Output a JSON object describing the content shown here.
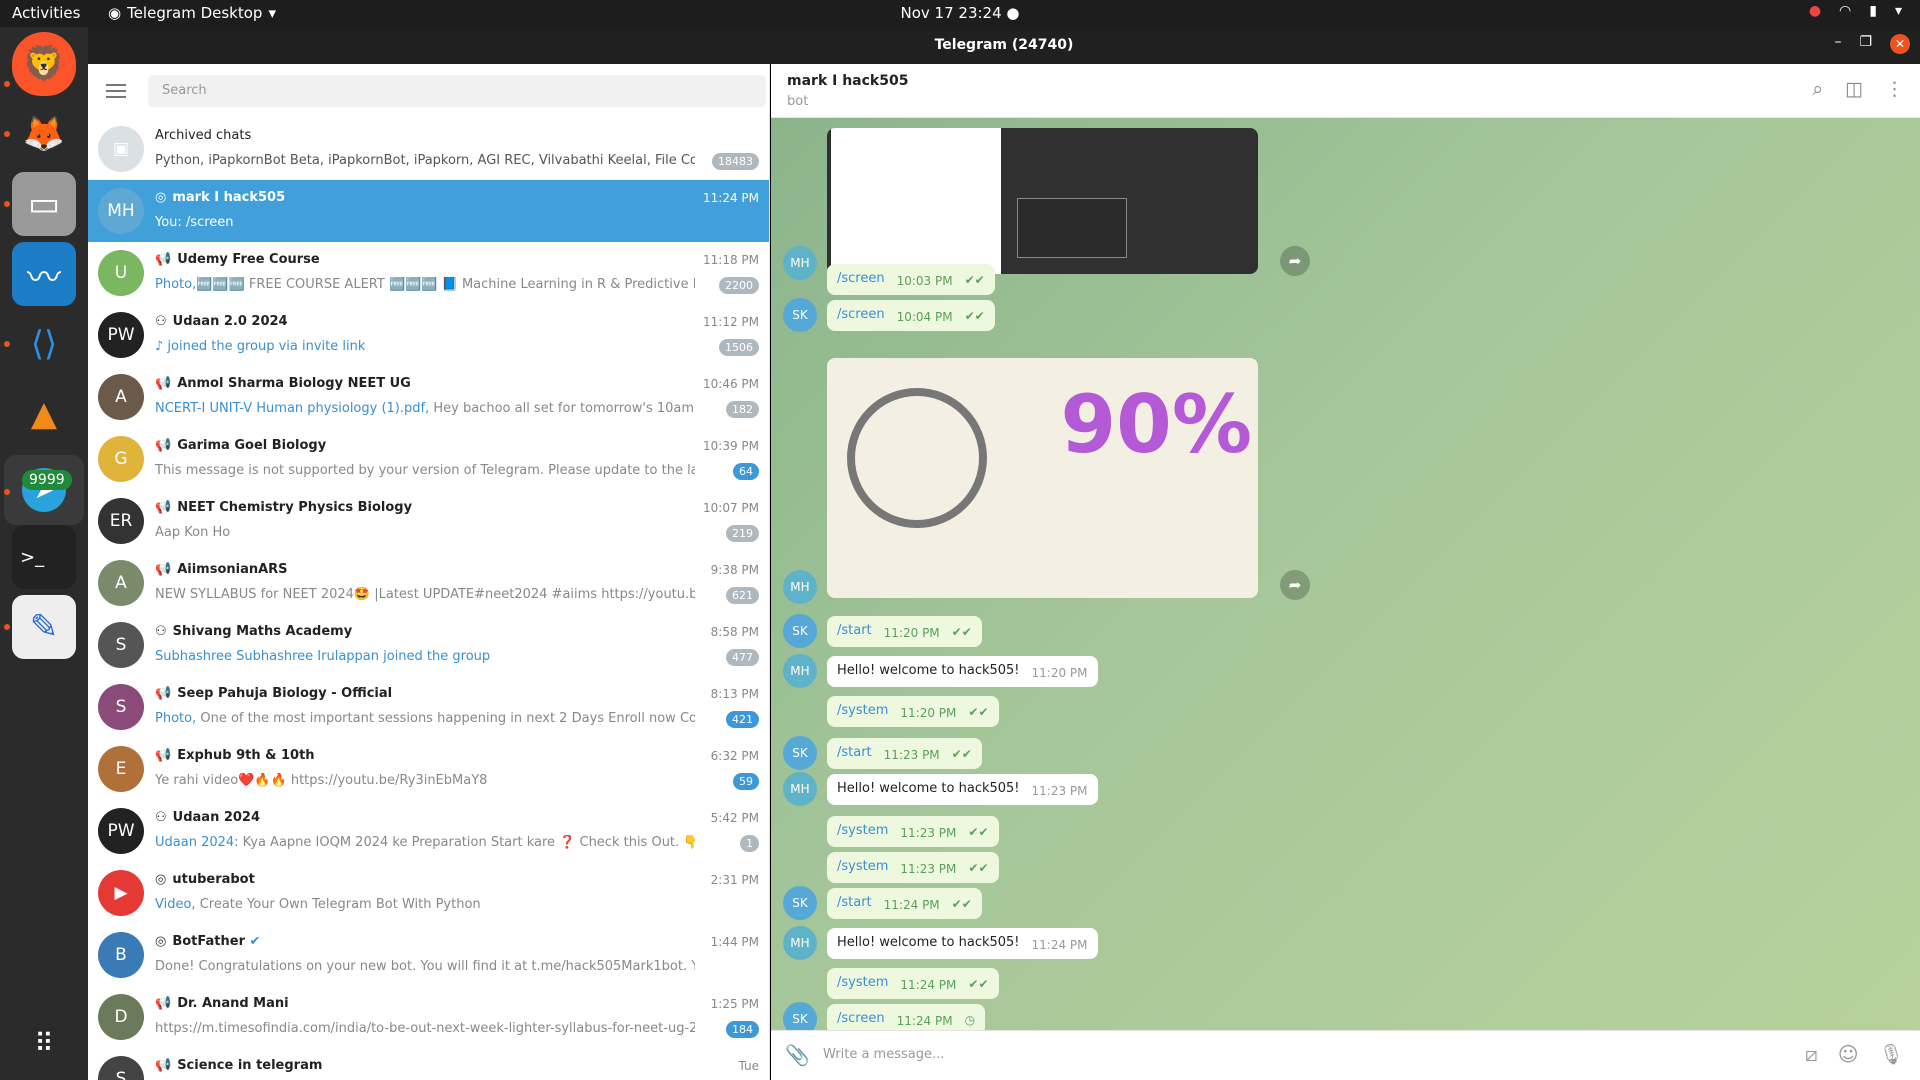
{
  "topbar": {
    "activities": "Activities",
    "app": "Telegram Desktop",
    "clock": "Nov 17  23:24"
  },
  "window": {
    "title": "Telegram (24740)"
  },
  "dock": {
    "telegram_badge": "9999"
  },
  "search": {
    "placeholder": "Search"
  },
  "archived": {
    "name": "Archived chats",
    "preview": "Python, iPapkornBot Beta, iPapkornBot, iPapkorn, AGI REC, Vilvabathi Keelal, File Convert...",
    "count": "18483"
  },
  "chats": [
    {
      "initials": "MH",
      "name": "mark I hack505",
      "time": "11:24 PM",
      "preview": "You: /screen",
      "badge": "",
      "active": true,
      "color": "#5fa8d3",
      "icon": "bot-icon"
    },
    {
      "initials": "U",
      "name": "Udemy Free Course",
      "time": "11:18 PM",
      "hl": "Photo,",
      "preview": "🆓🆓🆓 FREE COURSE ALERT 🆓🆓🆓 📘 Machine Learning in R & Predictive M...",
      "badge": "2200",
      "color": "#7bb661",
      "icon": "channel-icon"
    },
    {
      "initials": "PW",
      "name": "Udaan 2.0 2024",
      "time": "11:12 PM",
      "hl": "♪ joined the group via invite link",
      "preview": "",
      "badge": "1506",
      "color": "#222",
      "icon": "group-icon"
    },
    {
      "initials": "A",
      "name": "Anmol Sharma Biology NEET UG",
      "time": "10:46 PM",
      "hl": "NCERT-I UNIT-V Human physiology (1).pdf,",
      "preview": " Hey bachoo all set for tomorrow's 10am special c...",
      "badge": "182",
      "color": "#6b5a4a",
      "icon": "channel-icon"
    },
    {
      "initials": "G",
      "name": "Garima Goel Biology",
      "time": "10:39 PM",
      "preview": "This message is not supported by your version of Telegram. Please update to the latest versio...",
      "badge": "64",
      "blue": true,
      "color": "#e0b43a",
      "icon": "channel-icon"
    },
    {
      "initials": "ER",
      "name": "NEET Chemistry Physics Biology",
      "time": "10:07 PM",
      "preview": "Aap Kon Ho",
      "badge": "219",
      "color": "#333",
      "icon": "channel-icon"
    },
    {
      "initials": "A",
      "name": "AiimsonianARS",
      "time": "9:38 PM",
      "preview": "NEW SYLLABUS for NEET 2024🤩 |Latest UPDATE#neet2024 #aiims https://youtu.be/9Y4Ck...",
      "badge": "621",
      "color": "#7a8a6a",
      "icon": "channel-icon"
    },
    {
      "initials": "S",
      "name": "Shivang Maths Academy",
      "time": "8:58 PM",
      "hl": "Subhashree Subhashree Irulappan joined the group",
      "preview": "",
      "badge": "477",
      "color": "#555",
      "icon": "group-icon"
    },
    {
      "initials": "S",
      "name": "Seep Pahuja Biology - Official",
      "time": "8:13 PM",
      "hl": "Photo,",
      "preview": " One of the most important sessions happening in next 2 Days  Enroll now   Complete...",
      "badge": "421",
      "blue": true,
      "color": "#8a4a7a",
      "icon": "channel-icon"
    },
    {
      "initials": "E",
      "name": "Exphub 9th & 10th",
      "time": "6:32 PM",
      "preview": "Ye rahi video❤️🔥🔥  https://youtu.be/Ry3inEbMaY8",
      "badge": "59",
      "blue": true,
      "color": "#b0703a",
      "icon": "channel-icon"
    },
    {
      "initials": "PW",
      "name": "Udaan 2024",
      "time": "5:42 PM",
      "hl": "Udaan 2024:",
      "preview": " Kya Aapne IOQM 2024 ke Preparation Start kare ❓ Check this Out. 👇 https://yo...",
      "badge": "1",
      "color": "#222",
      "icon": "group-icon"
    },
    {
      "initials": "▶",
      "name": "utuberabot",
      "time": "2:31 PM",
      "hl": "Video,",
      "preview": " Create Your Own Telegram Bot With Python",
      "badge": "",
      "color": "#e53935",
      "icon": "bot-icon"
    },
    {
      "initials": "B",
      "name": "BotFather",
      "time": "1:44 PM",
      "preview": "Done! Congratulations on your new bot. You will find it at t.me/hack505Mark1bot. You can now ad...",
      "badge": "",
      "color": "#3a7ab5",
      "icon": "bot-icon",
      "verified": "✔"
    },
    {
      "initials": "D",
      "name": "Dr. Anand Mani",
      "time": "1:25 PM",
      "preview": "https://m.timesofindia.com/india/to-be-out-next-week-lighter-syllabus-for-neet-ug-2024/am...",
      "badge": "184",
      "blue": true,
      "color": "#6a7a5a",
      "icon": "channel-icon"
    },
    {
      "initials": "S",
      "name": "Science in telegram",
      "time": "Tue",
      "preview": "",
      "badge": "",
      "color": "#444",
      "icon": "channel-icon"
    }
  ],
  "chat": {
    "name": "mark I hack505",
    "status": "bot",
    "compose_placeholder": "Write a message..."
  },
  "messages": [
    {
      "type": "image",
      "from": "MH",
      "fwd": true
    },
    {
      "type": "out",
      "text": "/screen",
      "time": "10:03 PM",
      "from": "",
      "status": "✔✔"
    },
    {
      "type": "out",
      "text": "/screen",
      "time": "10:04 PM",
      "from": "SK",
      "status": "✔✔"
    },
    {
      "type": "image2",
      "from": "MH",
      "fwd": true,
      "overlay": "90%"
    },
    {
      "type": "out",
      "text": "/start",
      "time": "11:20 PM",
      "from": "SK",
      "status": "✔✔"
    },
    {
      "type": "in",
      "text": "Hello! welcome to hack505!",
      "time": "11:20 PM",
      "from": "MH"
    },
    {
      "type": "out",
      "text": "/system",
      "time": "11:20 PM",
      "from": "",
      "status": "✔✔"
    },
    {
      "type": "out",
      "text": "/start",
      "time": "11:23 PM",
      "from": "SK",
      "status": "✔✔"
    },
    {
      "type": "in",
      "text": "Hello! welcome to hack505!",
      "time": "11:23 PM",
      "from": "MH"
    },
    {
      "type": "out",
      "text": "/system",
      "time": "11:23 PM",
      "from": "",
      "status": "✔✔"
    },
    {
      "type": "out",
      "text": "/system",
      "time": "11:23 PM",
      "from": "",
      "status": "✔✔"
    },
    {
      "type": "out",
      "text": "/start",
      "time": "11:24 PM",
      "from": "SK",
      "status": "✔✔"
    },
    {
      "type": "in",
      "text": "Hello! welcome to hack505!",
      "time": "11:24 PM",
      "from": "MH"
    },
    {
      "type": "out",
      "text": "/system",
      "time": "11:24 PM",
      "from": "",
      "status": "✔✔"
    },
    {
      "type": "out",
      "text": "/screen",
      "time": "11:24 PM",
      "from": "SK",
      "status": "◷"
    }
  ]
}
